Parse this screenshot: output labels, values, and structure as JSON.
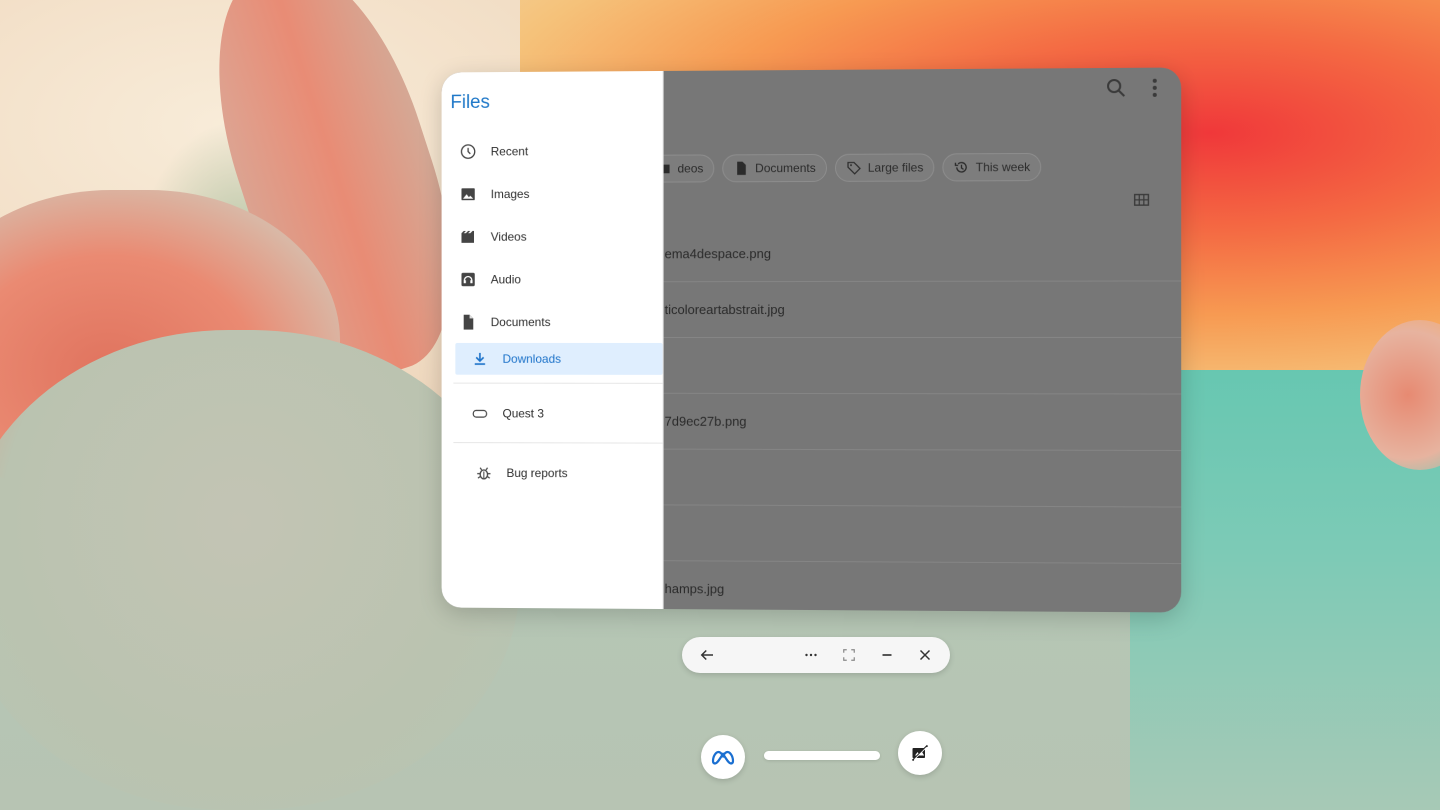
{
  "app": {
    "title": "Files"
  },
  "colors": {
    "accent": "#1f78c8",
    "active_bg": "#dfeefe",
    "scrim": "#777777"
  },
  "toolbar": {
    "search_icon": "search-icon",
    "more_icon": "more-vert-icon"
  },
  "chips": [
    {
      "label": "deos",
      "icon": "video-icon"
    },
    {
      "label": "Documents",
      "icon": "document-icon"
    },
    {
      "label": "Large files",
      "icon": "tag-icon"
    },
    {
      "label": "This week",
      "icon": "history-icon"
    }
  ],
  "files": [
    {
      "name": "ema4despace.png"
    },
    {
      "name": "ticoloreartabstrait.jpg"
    },
    {
      "name": ""
    },
    {
      "name": "7d9ec27b.png"
    },
    {
      "name": ""
    },
    {
      "name": ""
    },
    {
      "name": "hamps.jpg"
    }
  ],
  "sidebar": {
    "items": [
      {
        "label": "Recent",
        "icon": "clock-icon"
      },
      {
        "label": "Images",
        "icon": "image-icon"
      },
      {
        "label": "Videos",
        "icon": "video-icon"
      },
      {
        "label": "Audio",
        "icon": "headphones-icon"
      },
      {
        "label": "Documents",
        "icon": "document-icon"
      },
      {
        "label": "Downloads",
        "icon": "download-icon",
        "active": true
      }
    ],
    "devices": [
      {
        "label": "Quest 3",
        "icon": "headset-icon"
      }
    ],
    "other": [
      {
        "label": "Bug reports",
        "icon": "bug-icon"
      }
    ]
  },
  "window_controls": {
    "back_icon": "arrow-left-icon",
    "more_icon": "more-horiz-icon",
    "fullscreen_icon": "fullscreen-icon",
    "minimize_icon": "minimize-icon",
    "close_icon": "close-icon"
  },
  "system_bar": {
    "meta_icon": "meta-logo-icon",
    "camera_off_icon": "camera-off-icon"
  }
}
